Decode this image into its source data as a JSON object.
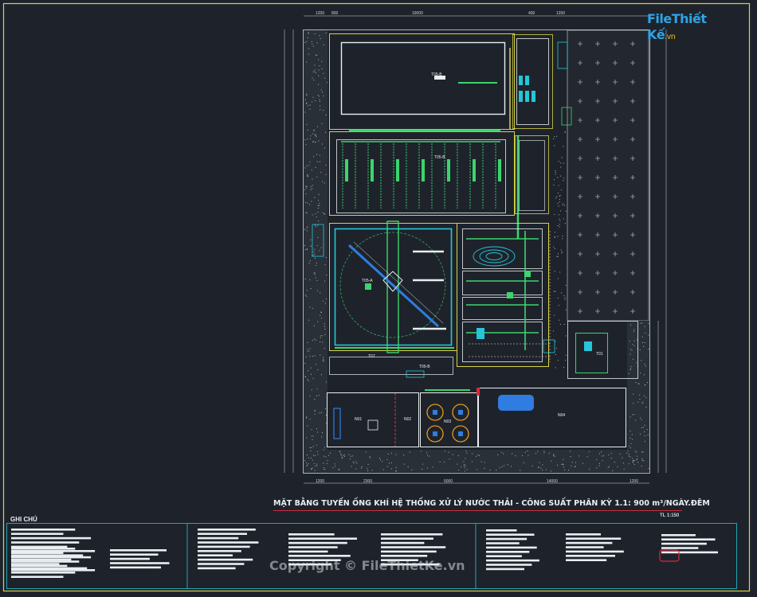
{
  "brand": {
    "logo_text": "FileThiết Kế",
    "logo_domain": ".vn"
  },
  "drawing": {
    "title": "MẶT BẰNG TUYẾN ỐNG KHÍ HỆ THỐNG XỬ LÝ NƯỚC THẢI - CÔNG SUẤT PHÂN KỲ 1.1: 900 m³/NGÀY.ĐÊM",
    "scale": "TL 1:150",
    "notes_heading": "GHI CHÚ",
    "watermark": "Copyright © FileThietKe.vn"
  },
  "tanks": [
    {
      "id": "T05-B"
    },
    {
      "id": "T05-B"
    },
    {
      "id": "T05-A"
    },
    {
      "id": "T07"
    },
    {
      "id": "T06-B"
    },
    {
      "id": "T01"
    },
    {
      "id": "N01"
    },
    {
      "id": "N02"
    },
    {
      "id": "N03"
    },
    {
      "id": "N04"
    }
  ],
  "dimensions": {
    "top": [
      "1200",
      "800",
      "19000",
      "400",
      "1200"
    ],
    "bottom": [
      "1200",
      "2300",
      "5000",
      "14000",
      "1200"
    ]
  },
  "colors": {
    "background": "#1e232b",
    "frame": "#d8d347",
    "pipe_green": "#3bd56d",
    "pipe_yellow": "#d8d347",
    "cyan": "#24c6d8",
    "red": "#d6293e",
    "orange": "#e69a1c",
    "blue": "#2f7de0",
    "white": "#e9eef2"
  }
}
